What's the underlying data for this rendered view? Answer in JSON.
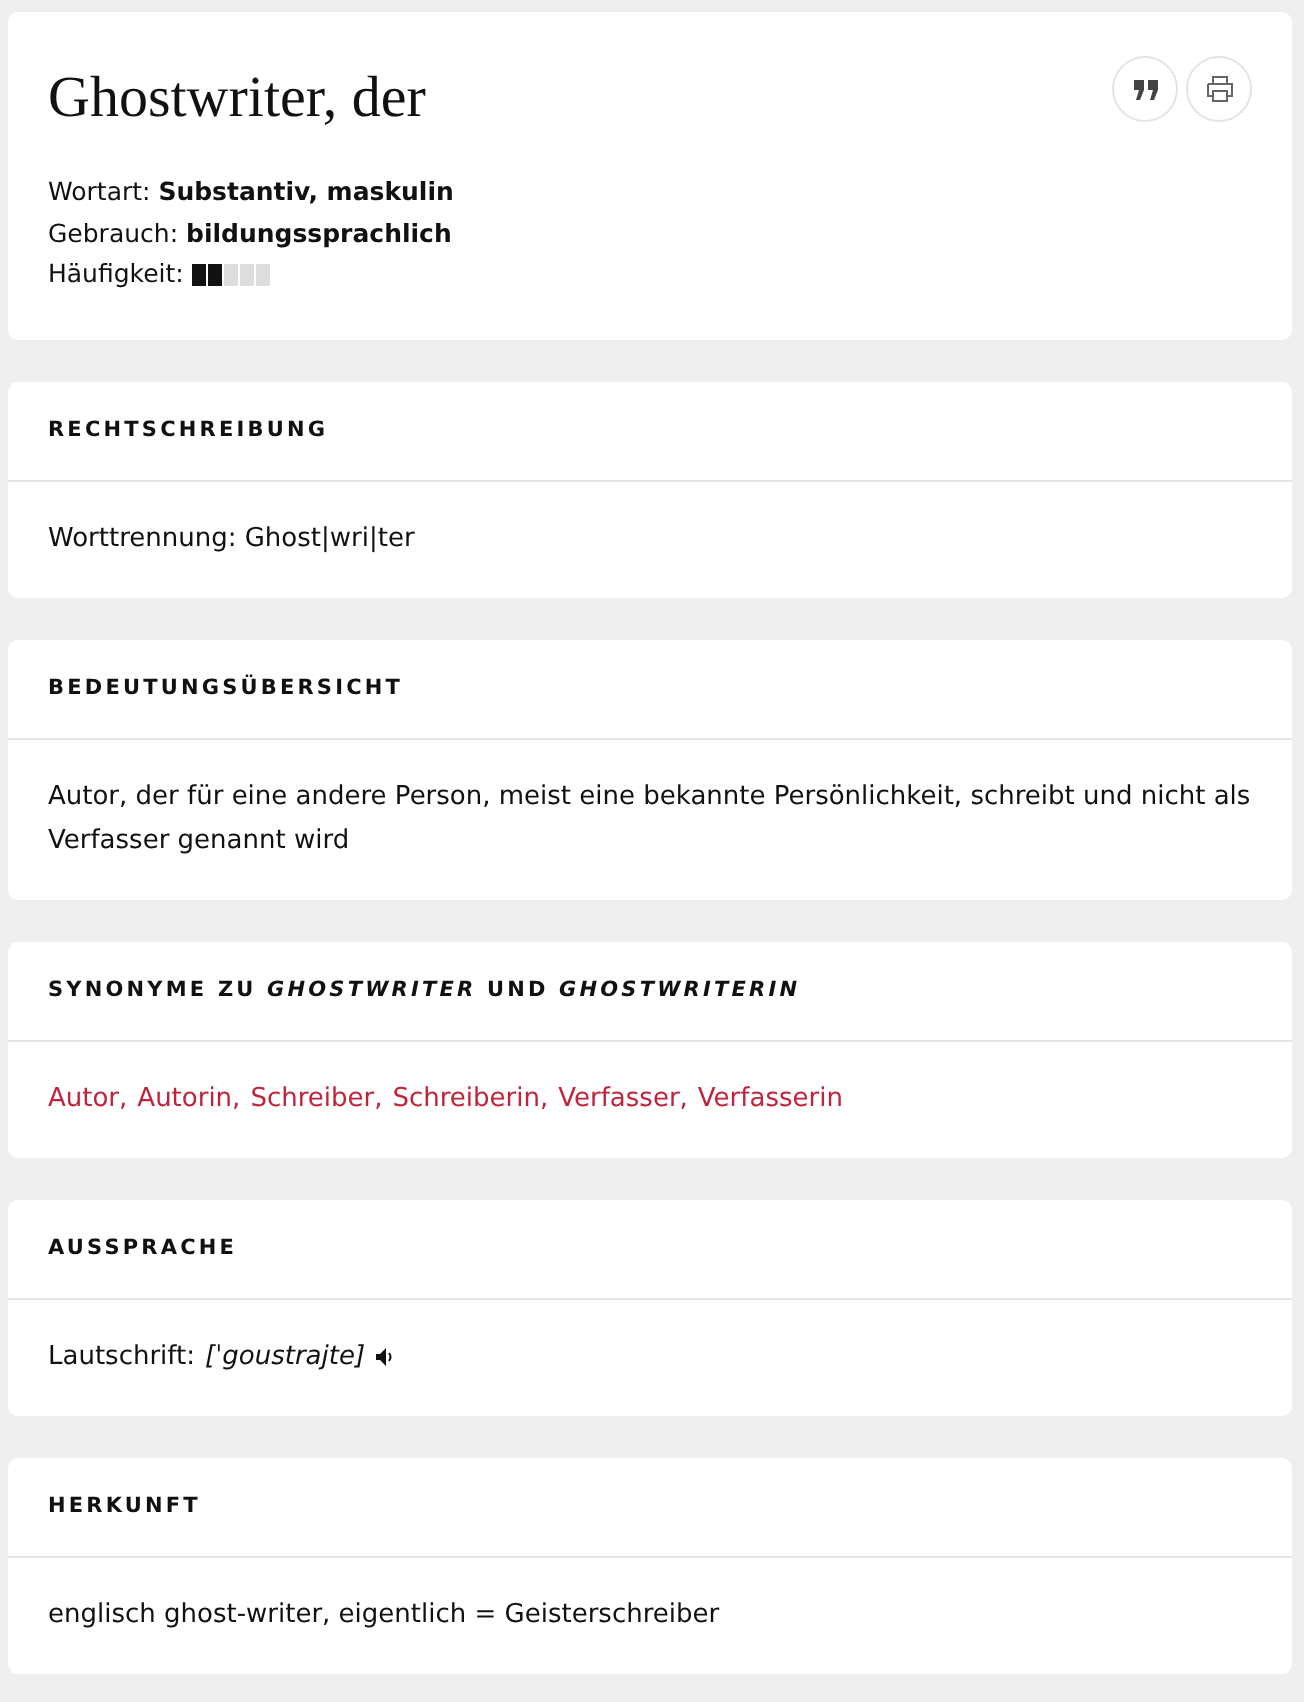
{
  "entry": {
    "title": "Ghostwriter, der",
    "facts": [
      {
        "label": "Wortart:",
        "value": "Substantiv, maskulin"
      },
      {
        "label": "Gebrauch:",
        "value": "bildungssprachlich"
      }
    ],
    "frequency": {
      "label": "Häufigkeit:",
      "stars": 2
    }
  },
  "sections": [
    {
      "kind": "text",
      "heading": "RECHTSCHREIBUNG",
      "text": "Worttrennung: Ghost|wri|ter"
    },
    {
      "kind": "text",
      "heading": "BEDEUTUNGSÜBERSICHT",
      "text": "Autor, der für eine andere Person, meist eine bekannte Persönlichkeit, schreibt und nicht als Verfasser genannt wird"
    },
    {
      "kind": "links",
      "heading": "SYNONYME ZU *GHOSTWRITER* UND *GHOSTWRITERIN*",
      "links": [
        "Autor,",
        "Autorin,",
        "Schreiber,",
        "Schreiberin,",
        "Verfasser,",
        "Verfasserin"
      ]
    },
    {
      "kind": "pronunciation",
      "heading": "AUSSPRACHE",
      "label": "Lautschrift:",
      "ipa": "[ˈgoustrajte]"
    },
    {
      "kind": "text",
      "heading": "HERKUNFT",
      "text": "englisch ghost-writer, eigentlich  = Geisterschreiber"
    }
  ]
}
